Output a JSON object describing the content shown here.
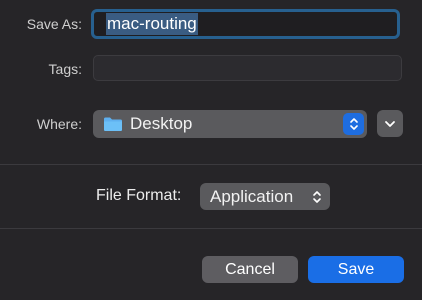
{
  "form": {
    "save_as_label": "Save As:",
    "file_name": "mac-routing",
    "tags_label": "Tags:",
    "tags_value": "",
    "where_label": "Where:",
    "where_value": "Desktop",
    "where_icon": "folder-icon",
    "file_format_label": "File Format:",
    "file_format_value": "Application"
  },
  "buttons": {
    "cancel_label": "Cancel",
    "save_label": "Save"
  },
  "colors": {
    "background": "#262528",
    "accent": "#1a6ee6",
    "focus_ring": "#27608f",
    "popup": "#5a5a5d"
  }
}
